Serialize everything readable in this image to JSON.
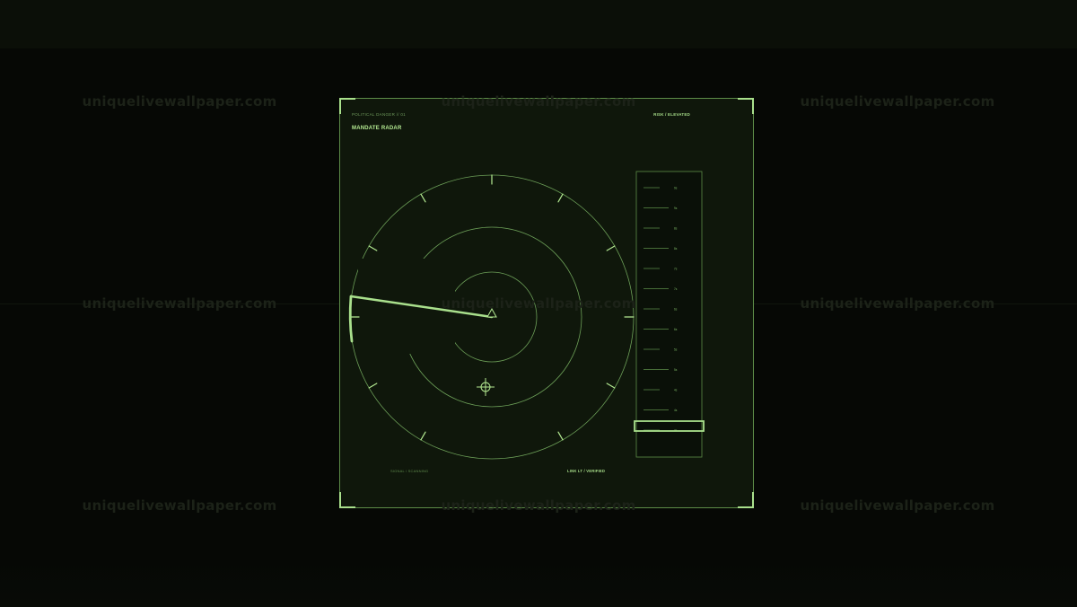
{
  "watermark": "uniquelivewallpaper.com",
  "panel": {
    "eyebrow": "POLITICAL DANGER // 01",
    "title": "MANDATE RADAR",
    "risk_status": "RISK / ELEVATED",
    "signal_status": "SIGNAL / SCANNING",
    "link_status": "LINK LT / VERIFIED"
  },
  "scale": {
    "labels": [
      "9s",
      "9s",
      "8s",
      "8s",
      "7s",
      "7s",
      "6s",
      "6s",
      "5s",
      "5s",
      "4s",
      "4s",
      "3s"
    ],
    "selected_index": 12
  },
  "colors": {
    "accent": "#a9e08c",
    "ring": "#7eb866",
    "panel_bg": "#0f170b",
    "page_bg": "#060805"
  },
  "icons": {
    "crosshair": "crosshair-icon",
    "center_marker": "triangle-icon"
  }
}
